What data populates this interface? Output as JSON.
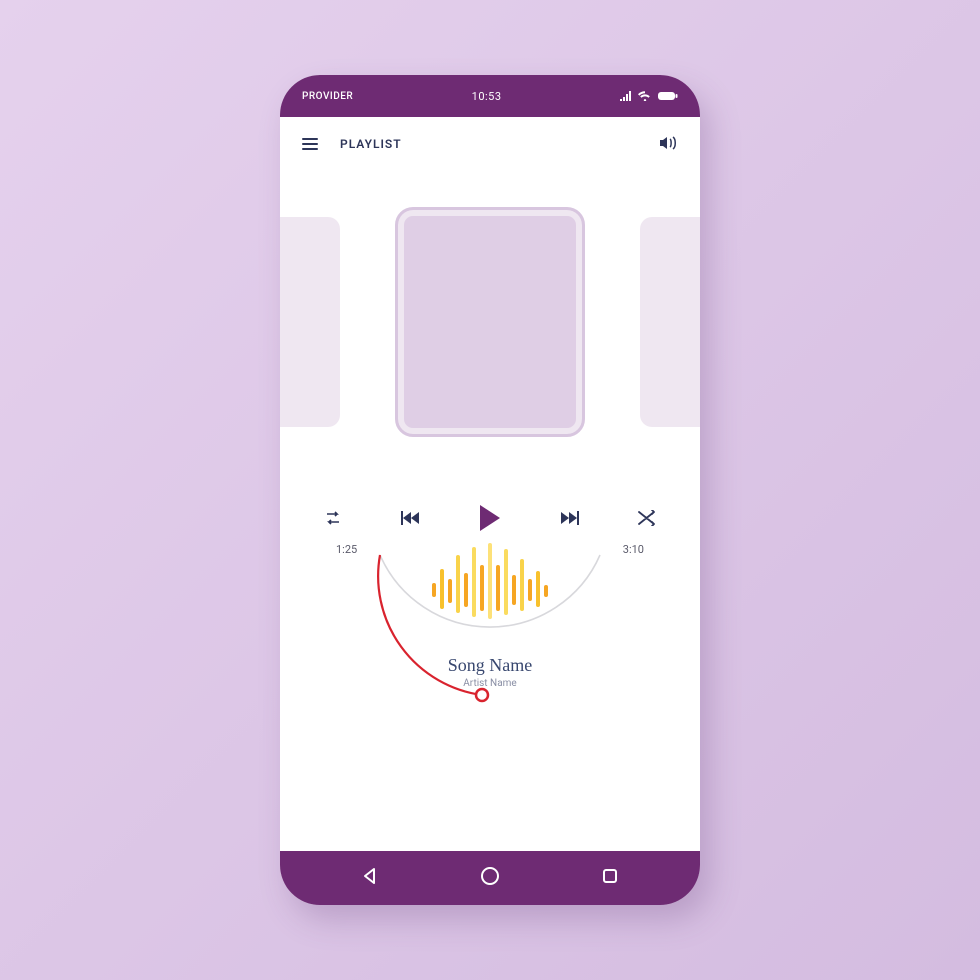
{
  "status": {
    "provider": "PROVIDER",
    "time": "10:53"
  },
  "header": {
    "title": "PLAYLIST"
  },
  "playback": {
    "elapsed": "1:25",
    "total": "3:10"
  },
  "track": {
    "title": "Song Name",
    "artist": "Artist Name"
  },
  "colors": {
    "accent": "#6e2b73",
    "progress": "#d9232e",
    "text": "#2d3559"
  }
}
